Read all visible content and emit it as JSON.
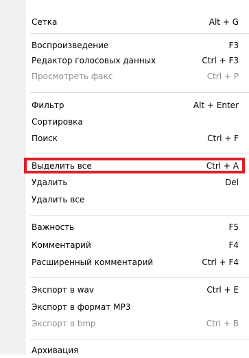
{
  "menu": {
    "items": [
      {
        "label": "Сетка",
        "shortcut": "Alt + G",
        "enabled": true
      },
      {
        "label": "Воспроизведение",
        "shortcut": "F3",
        "enabled": true
      },
      {
        "label": "Редактор голосовых данных",
        "shortcut": "Ctrl + F3",
        "enabled": true
      },
      {
        "label": "Просмотреть факс",
        "shortcut": "Ctrl + P",
        "enabled": false
      },
      {
        "label": "Фильтр",
        "shortcut": "Alt + Enter",
        "enabled": true
      },
      {
        "label": "Сортировка",
        "shortcut": "",
        "enabled": true
      },
      {
        "label": "Поиск",
        "shortcut": "Ctrl + F",
        "enabled": true
      },
      {
        "label": "Выделить все",
        "shortcut": "Ctrl + A",
        "enabled": true
      },
      {
        "label": "Удалить",
        "shortcut": "Del",
        "enabled": true
      },
      {
        "label": "Удалить все",
        "shortcut": "",
        "enabled": true
      },
      {
        "label": "Важность",
        "shortcut": "F5",
        "enabled": true
      },
      {
        "label": "Комментарий",
        "shortcut": "F4",
        "enabled": true
      },
      {
        "label": "Расширенный комментарий",
        "shortcut": "Ctrl + F4",
        "enabled": true
      },
      {
        "label": "Экспорт в wav",
        "shortcut": "Ctrl + E",
        "enabled": true
      },
      {
        "label": "Экспорт в формат MP3",
        "shortcut": "",
        "enabled": true
      },
      {
        "label": "Экспорт в bmp",
        "shortcut": "Ctrl + B",
        "enabled": false
      },
      {
        "label": "Архивация",
        "shortcut": "",
        "enabled": true
      }
    ],
    "highlighted_item": "Выделить все",
    "highlight_color": "#e01e24"
  }
}
